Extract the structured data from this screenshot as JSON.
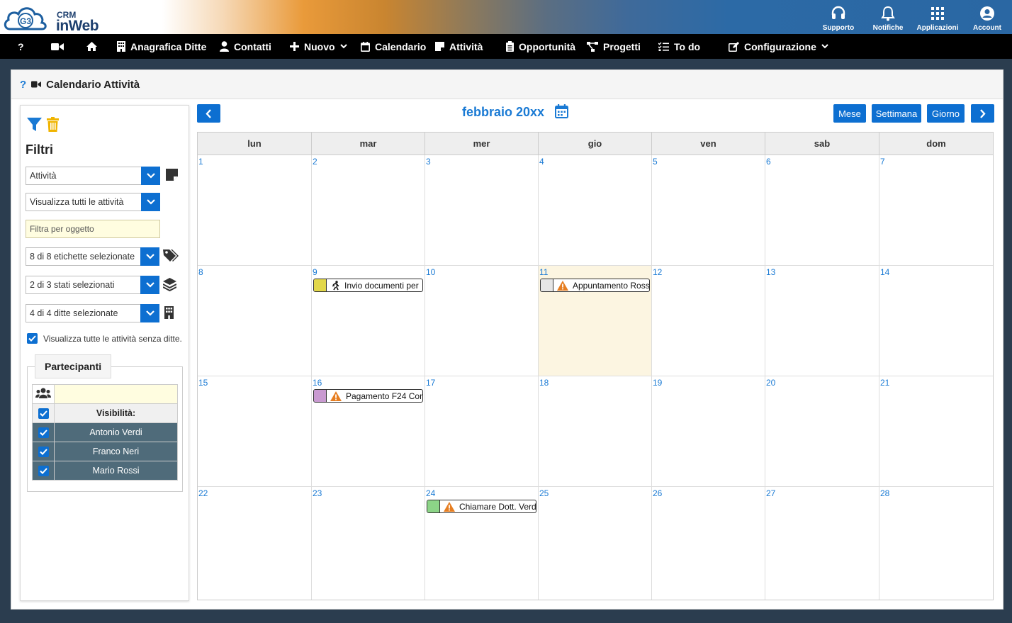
{
  "app": {
    "logo_badge": "G3",
    "logo_crm": "CRM",
    "logo_name": "inWeb"
  },
  "top_actions": [
    {
      "label": "Supporto",
      "icon": "headset-icon"
    },
    {
      "label": "Notifiche",
      "icon": "bell-icon"
    },
    {
      "label": "Applicazioni",
      "icon": "grid-icon"
    },
    {
      "label": "Account",
      "icon": "user-circle-icon"
    }
  ],
  "nav": {
    "help": "?",
    "items": [
      {
        "label": "Anagrafica Ditte",
        "icon": "building-icon"
      },
      {
        "label": "Contatti",
        "icon": "user-icon"
      },
      {
        "label": "Nuovo",
        "icon": "plus-icon"
      },
      {
        "label": "Calendario",
        "icon": "calendar-icon"
      },
      {
        "label": "Attività",
        "icon": "note-icon"
      },
      {
        "label": "Opportunità",
        "icon": "clipboard-icon"
      },
      {
        "label": "Progetti",
        "icon": "project-diagram-icon"
      },
      {
        "label": "To do",
        "icon": "list-check-icon"
      },
      {
        "label": "Configurazione",
        "icon": "edit-icon"
      }
    ]
  },
  "page": {
    "help": "?",
    "title": "Calendario Attività"
  },
  "filters": {
    "title": "Filtri",
    "type_select": "Attività",
    "visibility_select": "Visualizza tutti le attività",
    "object_placeholder": "Filtra per oggetto",
    "labels_select": "8 di 8 etichette selezionate",
    "states_select": "2 di 3 stati selezionati",
    "companies_select": "4 di 4 ditte selezionate",
    "show_without_company": "Visualizza tutte le attività senza ditte."
  },
  "participants": {
    "title": "Partecipanti",
    "visibility_header": "Visibilità:",
    "people": [
      "Antonio Verdi",
      "Franco Neri",
      "Mario Rossi"
    ]
  },
  "calendar": {
    "title": "febbraio 20xx",
    "views": [
      "Mese",
      "Settimana",
      "Giorno"
    ],
    "weekdays": [
      "lun",
      "mar",
      "mer",
      "gio",
      "ven",
      "sab",
      "dom"
    ],
    "today": 11,
    "events": [
      {
        "day": 9,
        "title": "Invio documenti per",
        "color": "#e2d74a",
        "icon": "running-icon"
      },
      {
        "day": 11,
        "title": "Appuntamento Ross",
        "color": "#e6e6e6",
        "icon": "warning-icon"
      },
      {
        "day": 16,
        "title": "Pagamento F24 Con",
        "color": "#c99ad1",
        "icon": "warning-icon"
      },
      {
        "day": 24,
        "title": "Chiamare Dott. Verd",
        "color": "#8cd487",
        "icon": "warning-icon"
      }
    ]
  },
  "colors": {
    "primary": "#0d6fd1",
    "link": "#1a7ad4",
    "today_bg": "#fcf5e1",
    "participant_row": "#4f6b7a",
    "warning": "#e67e22"
  }
}
